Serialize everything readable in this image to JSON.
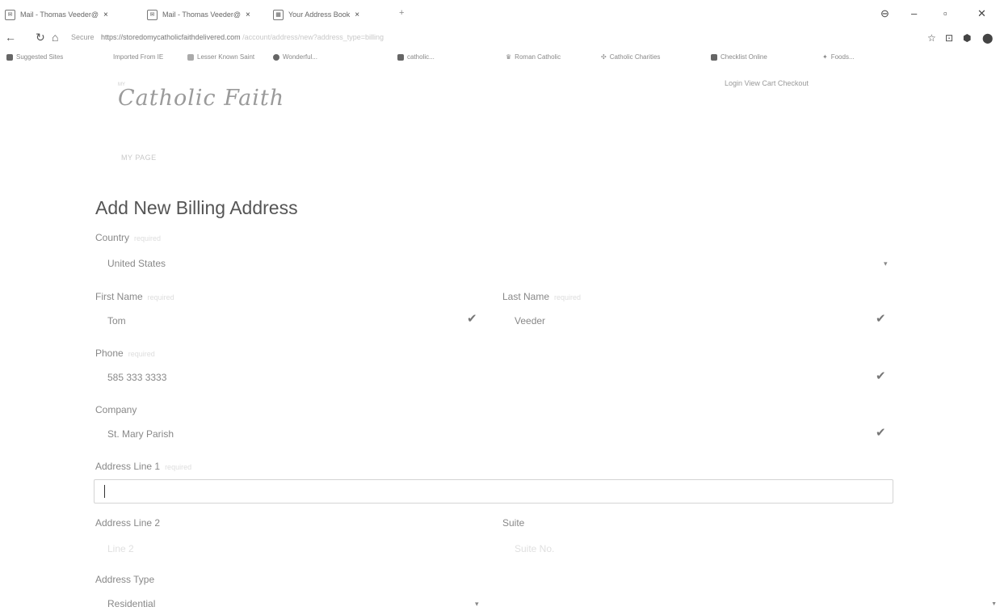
{
  "browser": {
    "tabs": [
      {
        "label": "Mail - Thomas Veeder@",
        "favicon": "envelope-icon"
      },
      {
        "label": "Mail - Thomas Veeder@",
        "favicon": "envelope-icon"
      },
      {
        "label": "Your Address Book",
        "favicon": "grid-icon"
      }
    ],
    "new_tab": "+",
    "url_prefix": "Secure",
    "url": "https://storedomycatholicfaithdelivered.com",
    "url_rest": "/account/address/new?address_type=billing",
    "bookmarks": [
      "Suggested Sites",
      "Imported From IE",
      "Lesser Known Saint",
      "Wonderful...",
      "catholic...",
      "Roman Catholic",
      "Catholic Charities",
      "Checklist Online",
      "Foods..."
    ]
  },
  "header": {
    "logo_small": "MY",
    "logo": "Catholic Faith",
    "links": "Login   View Cart   Checkout",
    "back_link": "MY PAGE"
  },
  "form": {
    "title": "Add New Billing Address",
    "country": {
      "label": "Country",
      "required": "required",
      "value": "United States"
    },
    "first_name": {
      "label": "First Name",
      "required": "required",
      "value": "Tom"
    },
    "last_name": {
      "label": "Last Name",
      "required": "required",
      "value": "Veeder"
    },
    "phone": {
      "label": "Phone",
      "required": "required",
      "value": "585 333 3333"
    },
    "company": {
      "label": "Company",
      "value": "St. Mary Parish"
    },
    "address1": {
      "label": "Address Line 1",
      "required": "required",
      "value": ""
    },
    "address2": {
      "label": "Address Line 2",
      "placeholder": "Line 2"
    },
    "suite": {
      "label": "Suite",
      "placeholder": "Suite No."
    },
    "address_type": {
      "label": "Address Type",
      "value": "Residential"
    }
  }
}
